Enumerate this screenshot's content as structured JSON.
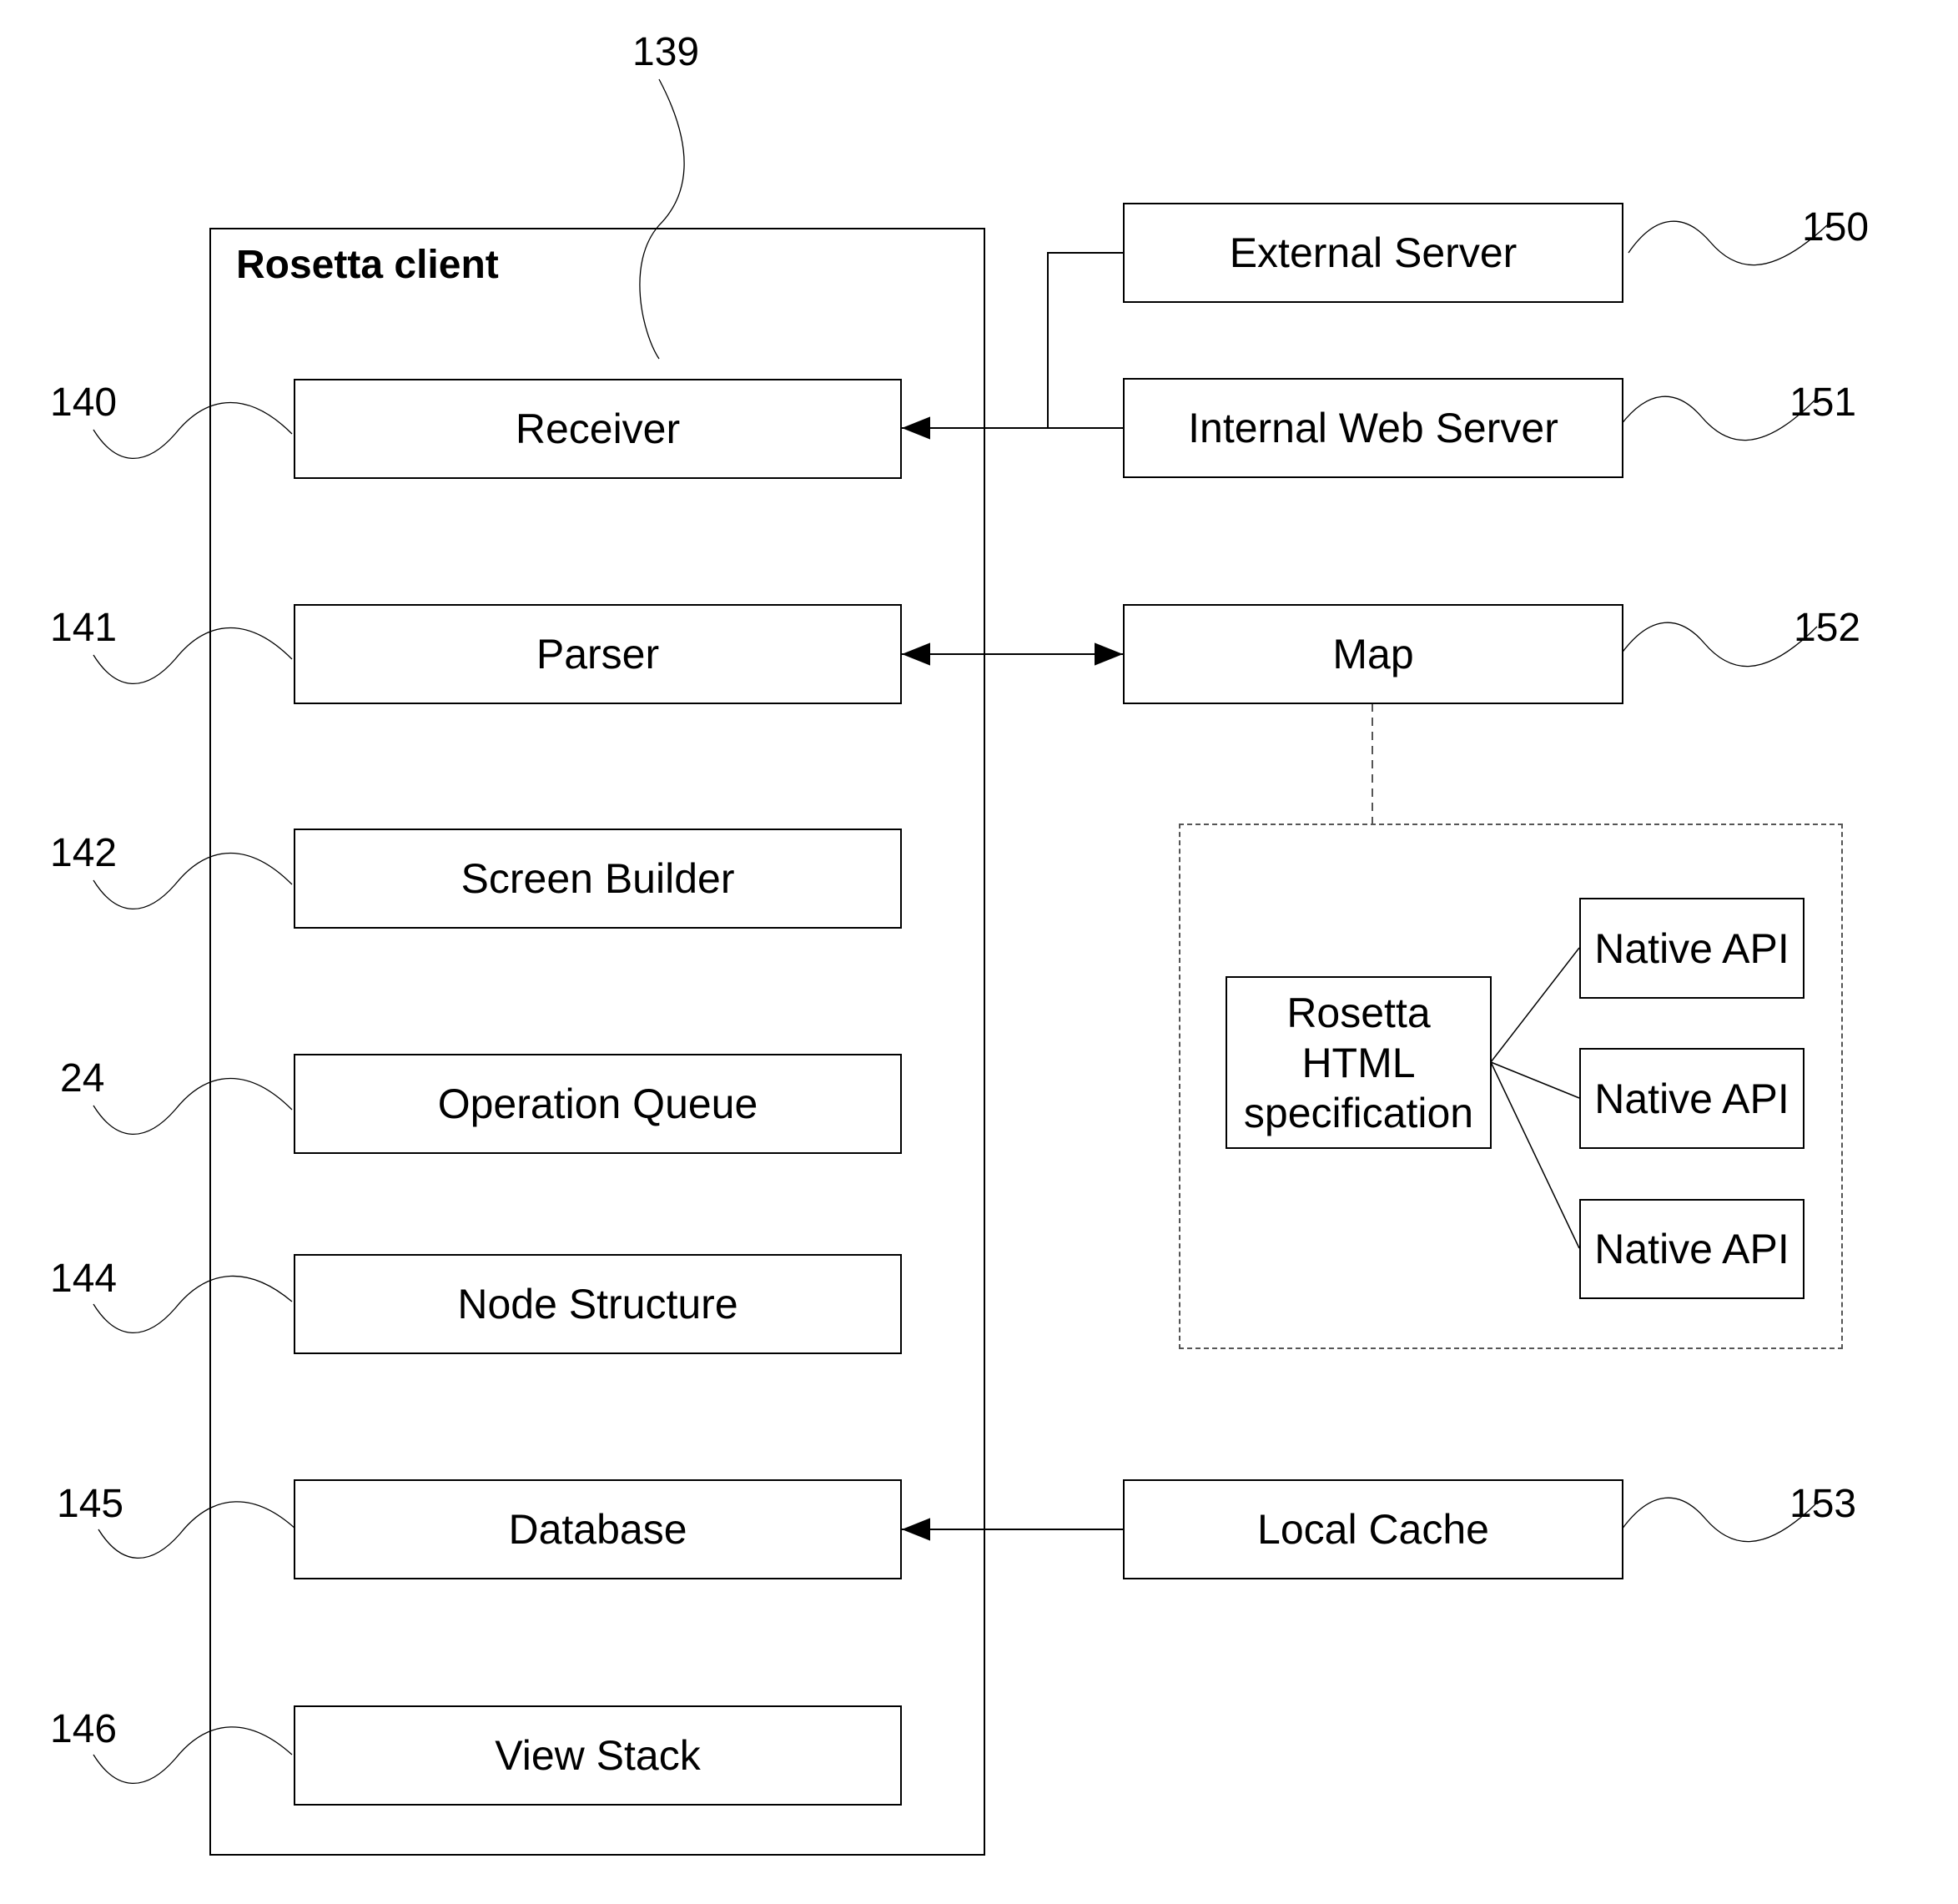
{
  "client": {
    "title": "Rosetta client",
    "ref": "139",
    "components": [
      {
        "label": "Receiver",
        "ref": "140"
      },
      {
        "label": "Parser",
        "ref": "141"
      },
      {
        "label": "Screen Builder",
        "ref": "142"
      },
      {
        "label": "Operation Queue",
        "ref": "24"
      },
      {
        "label": "Node Structure",
        "ref": "144"
      },
      {
        "label": "Database",
        "ref": "145"
      },
      {
        "label": "View Stack",
        "ref": "146"
      }
    ]
  },
  "external": {
    "external_server": {
      "label": "External Server",
      "ref": "150"
    },
    "internal_web_server": {
      "label": "Internal Web Server",
      "ref": "151"
    },
    "map": {
      "label": "Map",
      "ref": "152"
    },
    "local_cache": {
      "label": "Local Cache",
      "ref": "153"
    }
  },
  "map_detail": {
    "spec": {
      "label": "Rosetta\nHTML\nspecification"
    },
    "native_apis": [
      {
        "label": "Native API"
      },
      {
        "label": "Native API"
      },
      {
        "label": "Native API"
      }
    ]
  },
  "connections": [
    {
      "from": "External Server",
      "to": "Receiver",
      "arrow": "to"
    },
    {
      "from": "Internal Web Server",
      "to": "Receiver",
      "arrow": "to"
    },
    {
      "from": "Parser",
      "to": "Map",
      "arrow": "both"
    },
    {
      "from": "Map",
      "to": "Map detail",
      "style": "dashed"
    },
    {
      "from": "Rosetta HTML specification",
      "to": "Native API",
      "count": 3
    },
    {
      "from": "Local Cache",
      "to": "Database",
      "arrow": "to"
    }
  ]
}
